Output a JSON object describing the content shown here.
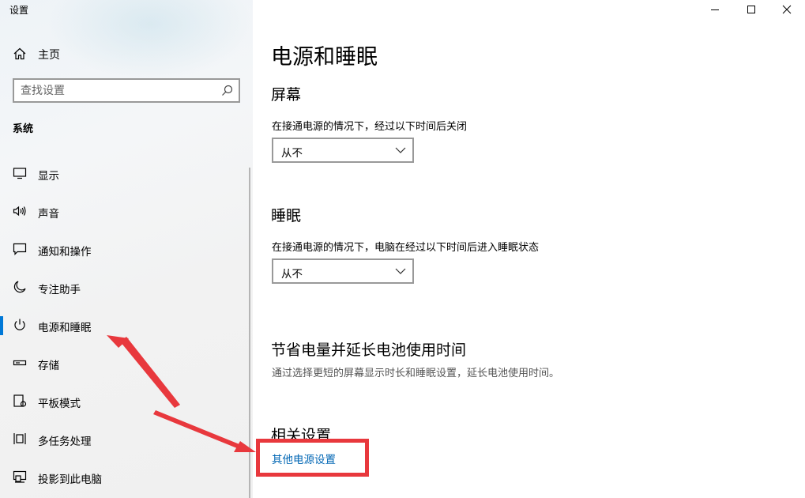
{
  "window": {
    "title": "设置"
  },
  "sidebar": {
    "home_label": "主页",
    "search_placeholder": "查找设置",
    "section_label": "系统",
    "items": [
      {
        "label": "显示",
        "icon": "monitor-icon"
      },
      {
        "label": "声音",
        "icon": "speaker-icon"
      },
      {
        "label": "通知和操作",
        "icon": "message-icon"
      },
      {
        "label": "专注助手",
        "icon": "moon-icon"
      },
      {
        "label": "电源和睡眠",
        "icon": "power-icon",
        "active": true
      },
      {
        "label": "存储",
        "icon": "storage-icon"
      },
      {
        "label": "平板模式",
        "icon": "tablet-icon"
      },
      {
        "label": "多任务处理",
        "icon": "multitask-icon"
      },
      {
        "label": "投影到此电脑",
        "icon": "project-icon"
      }
    ]
  },
  "main": {
    "title": "电源和睡眠",
    "screen": {
      "heading": "屏幕",
      "description": "在接通电源的情况下，经过以下时间后关闭",
      "value": "从不"
    },
    "sleep": {
      "heading": "睡眠",
      "description": "在接通电源的情况下，电脑在经过以下时间后进入睡眠状态",
      "value": "从不"
    },
    "battery": {
      "heading": "节省电量并延长电池使用时间",
      "description": "通过选择更短的屏幕显示时长和睡眠设置，延长电池使用时间。"
    },
    "related": {
      "heading": "相关设置",
      "link": "其他电源设置"
    }
  },
  "colors": {
    "accent": "#0078d7",
    "link": "#0066b4",
    "annotation": "#e8383d"
  }
}
